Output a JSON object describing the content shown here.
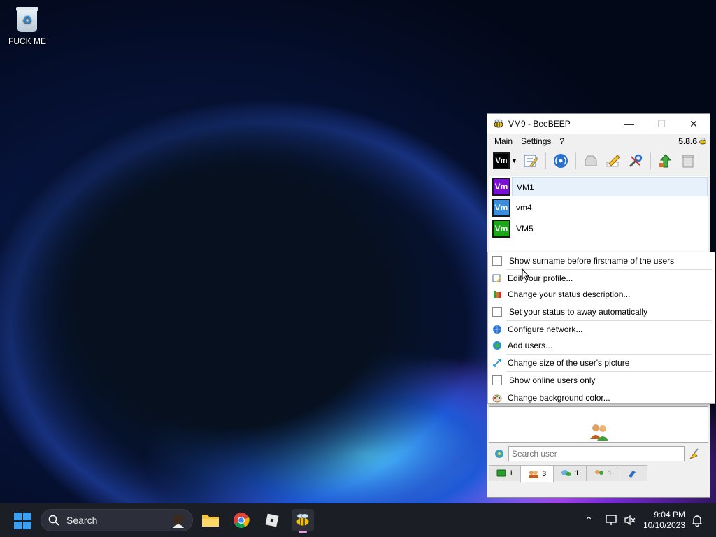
{
  "desktop": {
    "recycle_label": "FUCK ME"
  },
  "window": {
    "title": "VM9 - BeeBEEP",
    "minimize": "—",
    "maximize": "☐",
    "close": "✕",
    "menu": [
      "Main",
      "Settings",
      "?"
    ],
    "version": "5.8.6",
    "my_badge": "Vm"
  },
  "users": [
    {
      "badge": "Vm",
      "name": "VM1",
      "color": "#7a10d8"
    },
    {
      "badge": "Vm",
      "name": "vm4",
      "color": "#3a8ee0"
    },
    {
      "badge": "Vm",
      "name": "VM5",
      "color": "#18a818"
    }
  ],
  "search": {
    "placeholder": "Search user"
  },
  "tabs": [
    {
      "count": "1"
    },
    {
      "count": "3"
    },
    {
      "count": "1"
    },
    {
      "count": "1"
    },
    {
      "count": ""
    }
  ],
  "context_menu": {
    "show_surname": "Show surname before firstname of the users",
    "edit_profile": "Edit your profile...",
    "change_status_desc": "Change your status description...",
    "away_auto": "Set your status to away automatically",
    "configure_network": "Configure network...",
    "add_users": "Add users...",
    "change_picture_size": "Change size of the user's picture",
    "online_only": "Show online users only",
    "change_bg": "Change background color..."
  },
  "taskbar": {
    "search_label": "Search",
    "time": "9:04 PM",
    "date": "10/10/2023"
  },
  "colors": {
    "accent": "#3aa0f3",
    "taskbar_bg": "#1c1e26"
  }
}
